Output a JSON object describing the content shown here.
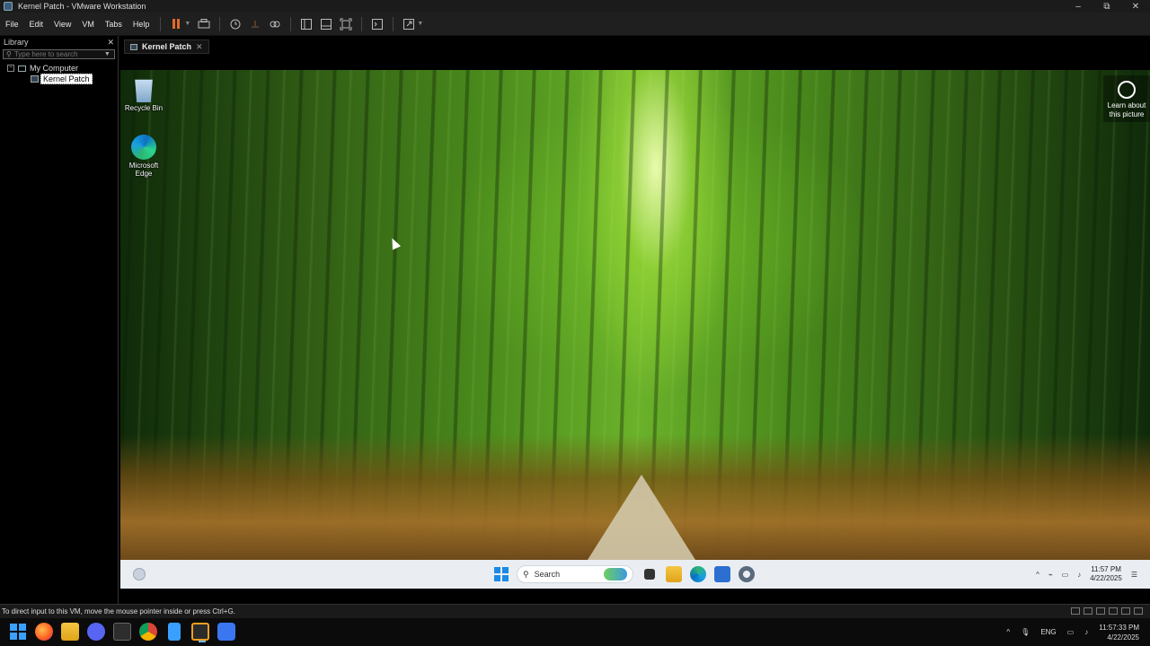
{
  "window": {
    "title": "Kernel Patch - VMware Workstation",
    "controls": [
      "–",
      "⧉",
      "✕"
    ]
  },
  "menu": {
    "items": [
      "File",
      "Edit",
      "View",
      "VM",
      "Tabs",
      "Help"
    ]
  },
  "library": {
    "title": "Library",
    "close": "✕",
    "search_placeholder": "Type here to search",
    "tree": {
      "root": "My Computer",
      "expander": "−",
      "child": "Kernel Patch"
    }
  },
  "vm_tab": {
    "label": "Kernel Patch",
    "close": "✕"
  },
  "guest": {
    "desktop_icons": [
      {
        "label": "Recycle Bin"
      },
      {
        "label": "Microsoft\nEdge"
      }
    ],
    "learn_picture": "Learn about\nthis picture",
    "taskbar": {
      "search_label": "Search",
      "time": "11:57 PM",
      "date": "4/22/2025"
    }
  },
  "status_bar": {
    "message": "To direct input to this VM, move the mouse pointer inside or press Ctrl+G."
  },
  "host_taskbar": {
    "language": "ENG",
    "time": "11:57:33 PM",
    "date": "4/22/2025"
  },
  "colors": {
    "pause_icon": "#e06a2b",
    "windows_blue": "#3aa0ff",
    "guest_taskbar": "#eaeef3"
  }
}
